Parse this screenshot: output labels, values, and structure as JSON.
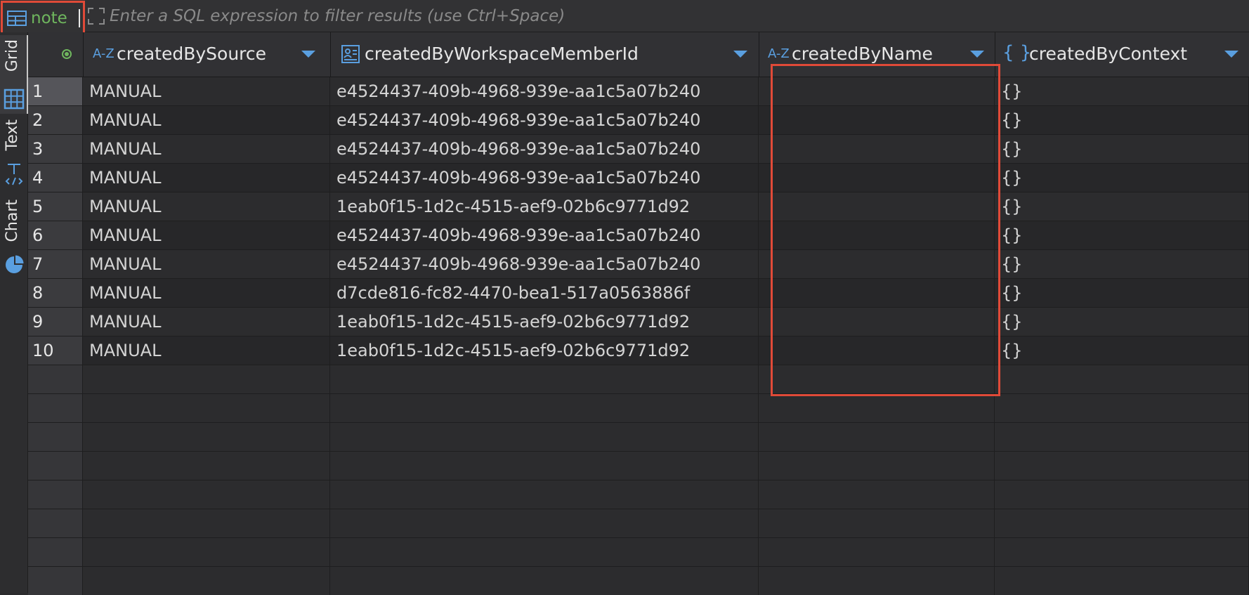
{
  "filter": {
    "entity": "note",
    "placeholder": "Enter a SQL expression to filter results (use Ctrl+Space)"
  },
  "view_tabs": [
    {
      "label": "Grid",
      "icon": "grid-icon",
      "active": true
    },
    {
      "label": "Text",
      "icon": "text-icon",
      "active": false
    },
    {
      "label": "Chart",
      "icon": "pie-chart-icon",
      "active": false
    }
  ],
  "columns": [
    {
      "name": "createdBySource",
      "type_icon": "A-Z",
      "type": "string"
    },
    {
      "name": "createdByWorkspaceMemberId",
      "type_icon": "id-card",
      "type": "uuid"
    },
    {
      "name": "createdByName",
      "type_icon": "A-Z",
      "type": "string"
    },
    {
      "name": "createdByContext",
      "type_icon": "{ }",
      "type": "json"
    }
  ],
  "rows": [
    {
      "n": "1",
      "source": "MANUAL",
      "member": "e4524437-409b-4968-939e-aa1c5a07b240",
      "name": "",
      "context": "{}"
    },
    {
      "n": "2",
      "source": "MANUAL",
      "member": "e4524437-409b-4968-939e-aa1c5a07b240",
      "name": "",
      "context": "{}"
    },
    {
      "n": "3",
      "source": "MANUAL",
      "member": "e4524437-409b-4968-939e-aa1c5a07b240",
      "name": "",
      "context": "{}"
    },
    {
      "n": "4",
      "source": "MANUAL",
      "member": "e4524437-409b-4968-939e-aa1c5a07b240",
      "name": "",
      "context": "{}"
    },
    {
      "n": "5",
      "source": "MANUAL",
      "member": "1eab0f15-1d2c-4515-aef9-02b6c9771d92",
      "name": "",
      "context": "{}"
    },
    {
      "n": "6",
      "source": "MANUAL",
      "member": "e4524437-409b-4968-939e-aa1c5a07b240",
      "name": "",
      "context": "{}"
    },
    {
      "n": "7",
      "source": "MANUAL",
      "member": "e4524437-409b-4968-939e-aa1c5a07b240",
      "name": "",
      "context": "{}"
    },
    {
      "n": "8",
      "source": "MANUAL",
      "member": "d7cde816-fc82-4470-bea1-517a0563886f",
      "name": "",
      "context": "{}"
    },
    {
      "n": "9",
      "source": "MANUAL",
      "member": "1eab0f15-1d2c-4515-aef9-02b6c9771d92",
      "name": "",
      "context": "{}"
    },
    {
      "n": "10",
      "source": "MANUAL",
      "member": "1eab0f15-1d2c-4515-aef9-02b6c9771d92",
      "name": "",
      "context": "{}"
    }
  ],
  "colors": {
    "highlight": "#e04a38",
    "entity_name": "#6fb65e",
    "type_icon": "#5a9fe0"
  }
}
